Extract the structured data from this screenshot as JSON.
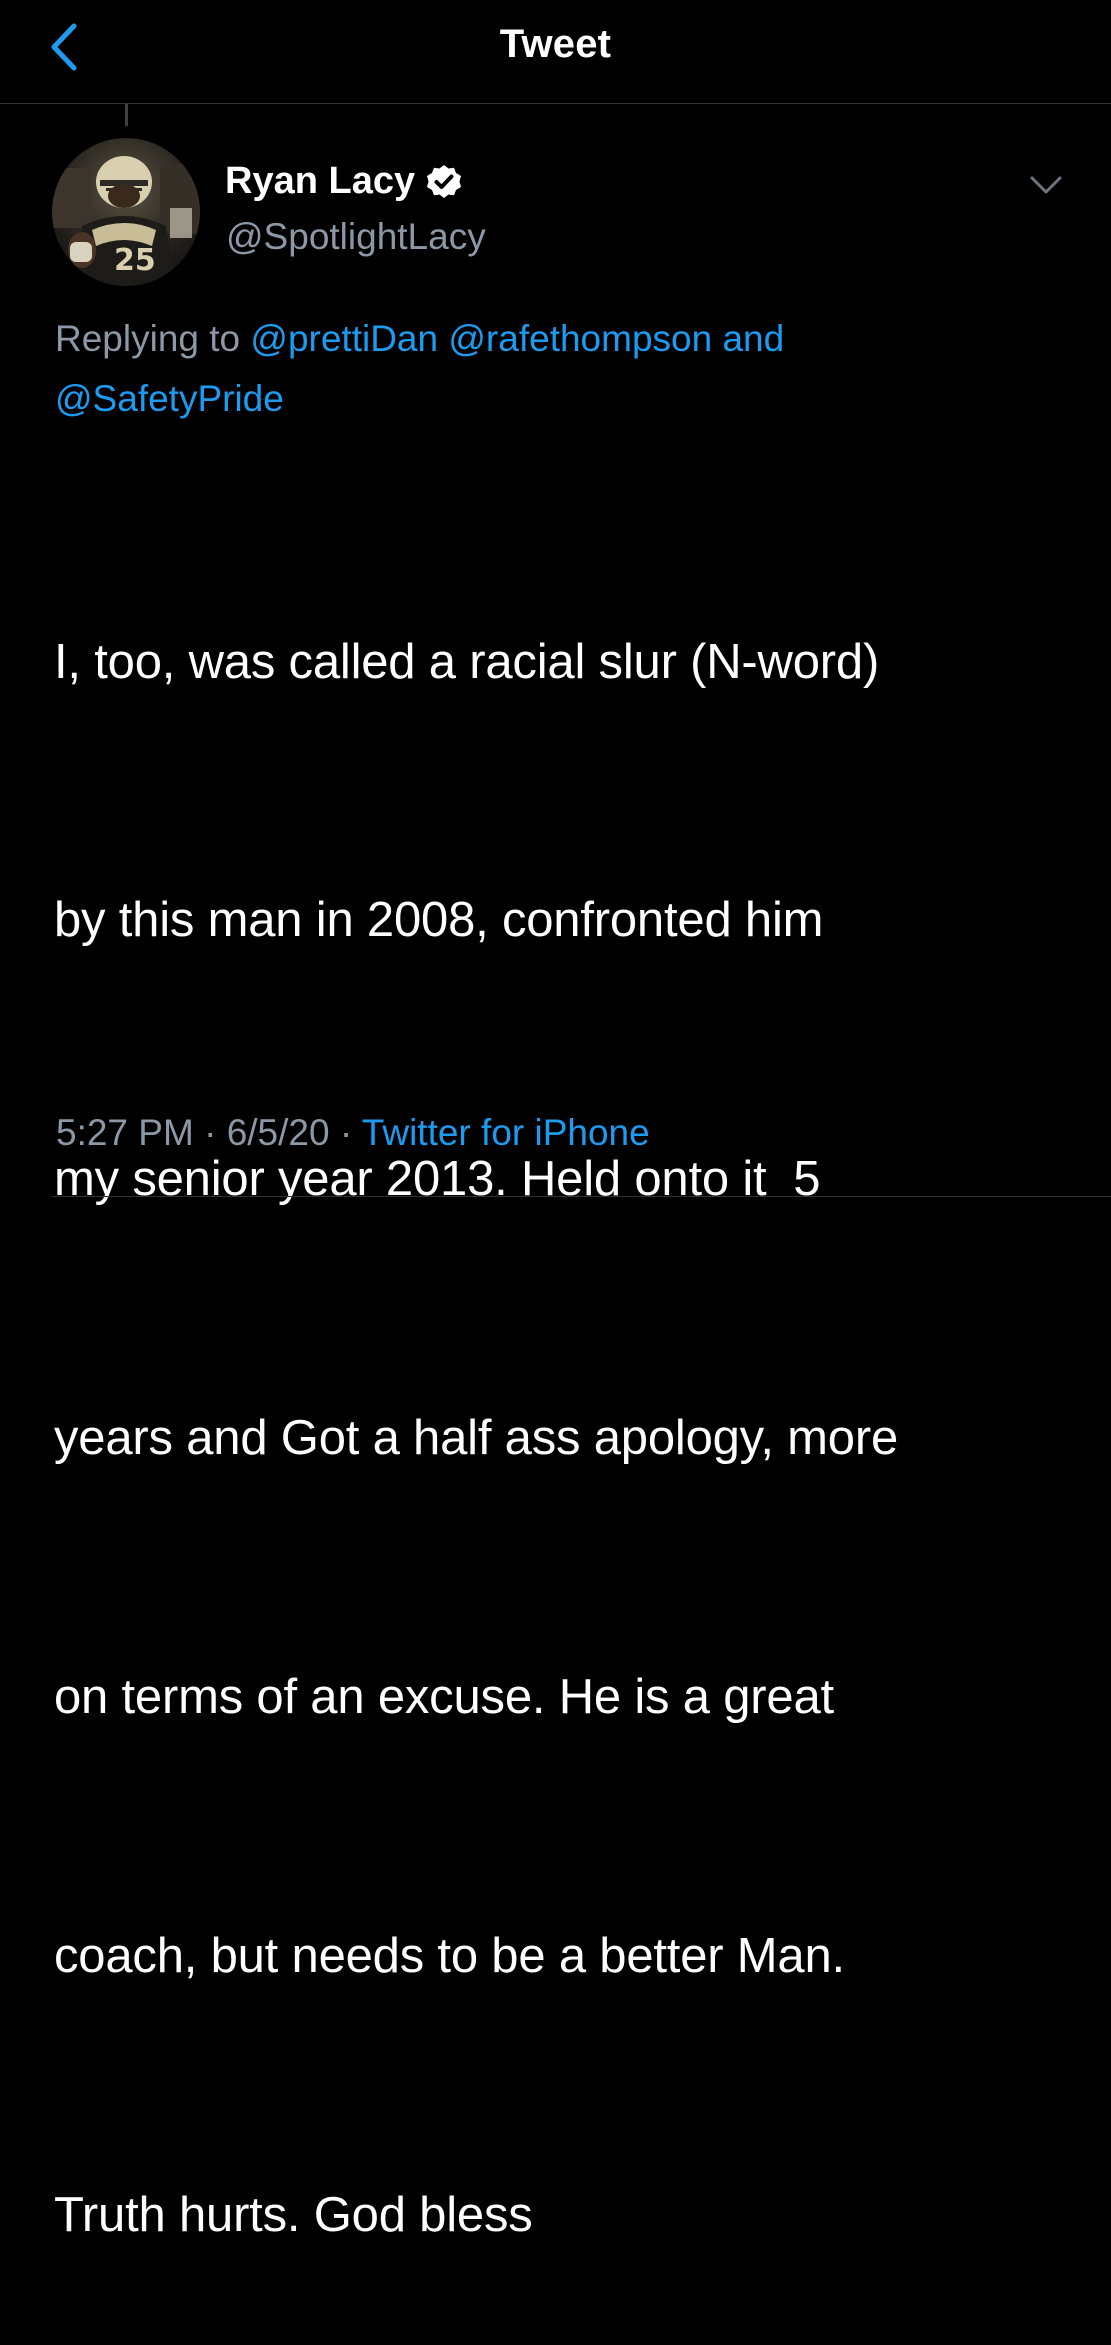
{
  "header": {
    "title": "Tweet",
    "back_icon": "chevron-left-icon"
  },
  "colors": {
    "background": "#000000",
    "accent": "#1d9bf0",
    "secondary_text": "#8b98a5",
    "divider": "#2f3336"
  },
  "tweet": {
    "author": {
      "name": "Ryan Lacy",
      "handle": "@SpotlightLacy",
      "verified": true,
      "verified_icon": "verified-badge-icon",
      "jersey_number": "25"
    },
    "menu_icon": "chevron-down-icon",
    "reply": {
      "prefix": "Replying to",
      "mention_1": "@prettiDan",
      "mention_2": "@rafethompson",
      "conjunction": "and",
      "mention_3": "@SafetyPride"
    },
    "text_lines": [
      "I, too, was called a racial slur (N-word)",
      "by this man in 2008, confronted him",
      "my senior year 2013. Held onto it  5",
      "years and Got a half ass apology, more",
      "on terms of an excuse. He is a great",
      "coach, but needs to be a better Man.",
      "Truth hurts. God bless"
    ],
    "time": "5:27 PM",
    "separator": "·",
    "date": "6/5/20",
    "source": "Twitter for iPhone"
  }
}
